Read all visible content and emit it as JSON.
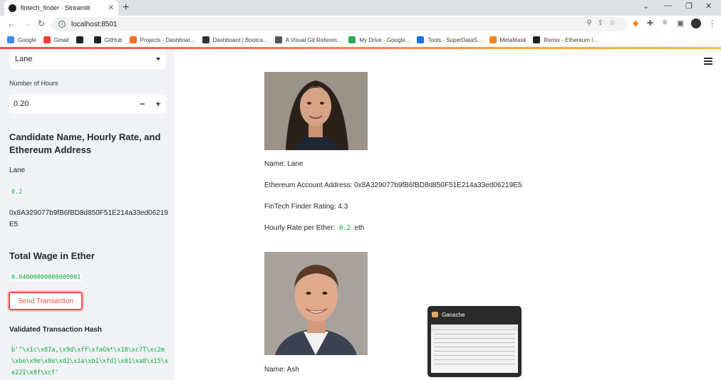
{
  "browser": {
    "tab_title": "fintech_finder · Streamlit",
    "tab_close": "✕",
    "new_tab": "+",
    "url": "localhost:8501",
    "window_controls": [
      "⌄",
      "—",
      "❐",
      "✕"
    ],
    "nav_icons": [
      "back-icon",
      "forward-icon",
      "reload-icon"
    ],
    "bookmarks": [
      {
        "label": "Google",
        "icon": "google-icon",
        "color": "#4285f4"
      },
      {
        "label": "Gmail",
        "icon": "gmail-icon",
        "color": "#ea4335"
      },
      {
        "label": "",
        "icon": "bookmark-icon",
        "color": "#202124"
      },
      {
        "label": "GitHub",
        "icon": "github-icon",
        "color": "#202124"
      },
      {
        "label": "Projects · Dashboar...",
        "icon": "gitlab-icon",
        "color": "#fc6d26"
      },
      {
        "label": "Dashboard | Bootca...",
        "icon": "dashboard-icon",
        "color": "#333333"
      },
      {
        "label": "A Visual Git Referen...",
        "icon": "globe-icon",
        "color": "#555555"
      },
      {
        "label": "My Drive - Google...",
        "icon": "drive-icon",
        "color": "#34a853"
      },
      {
        "label": "Tools - SuperDataS...",
        "icon": "superdatascience-icon",
        "color": "#1a73e8"
      },
      {
        "label": "MetaMask",
        "icon": "metamask-icon",
        "color": "#f6851b"
      },
      {
        "label": "Remix - Ethereum I...",
        "icon": "remix-icon",
        "color": "#222222"
      }
    ]
  },
  "sidebar": {
    "candidate_select_value": "Lane",
    "hours_label": "Number of Hours",
    "hours_value": "0.20",
    "minus": "−",
    "plus": "+",
    "candidate_heading": "Candidate Name, Hourly Rate, and Ethereum Address",
    "candidate_name": "Lane",
    "candidate_rate": "0.2",
    "candidate_address": "0x8A329077b9fB6fBD8d850F51E214a33ed06219E5",
    "wage_heading": "Total Wage in Ether",
    "wage_value": "0.04000000000000001",
    "send_button": "Send Transaction",
    "hash_heading": "Validated Transaction Hash",
    "hash_value": "b'^\\x1c\\x87a,\\x9d\\xff\\xfaG%*\\x18\\xc7T\\xc2m\\xbe\\x9e\\x0e\\xd2\\x1a\\xb1\\xfd}\\x01\\xa8\\x15\\xe2JI\\x8f\\xcf'"
  },
  "main": {
    "candidate1": {
      "name": "Name: Lane",
      "address": "Ethereum Account Address: 0x8A329077b9fB6fBD8d850F51E214a33ed06219E5",
      "rating": "FinTech Finder Rating: 4.3",
      "rate_prefix": "Hourly Rate per Ether:",
      "rate_value": "0.2",
      "rate_suffix": "eth"
    },
    "candidate2": {
      "name": "Name: Ash"
    }
  },
  "overlay": {
    "title": "Ganache"
  }
}
